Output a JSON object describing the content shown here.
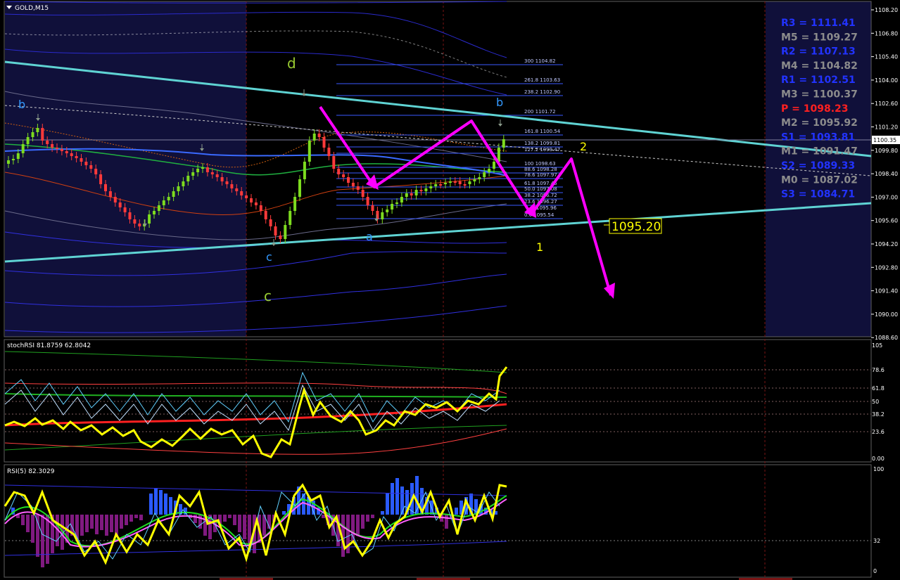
{
  "symbol_label": "GOLD,M15",
  "price_axis": [
    "1108.20",
    "1106.80",
    "1105.40",
    "1104.00",
    "1102.60",
    "1101.20",
    "1099.80",
    "1098.40",
    "1097.00",
    "1095.60",
    "1094.20",
    "1092.80",
    "1091.40",
    "1090.00",
    "1088.60"
  ],
  "current_price": "1100.35",
  "pivots": [
    {
      "label": "R3 = 1111.41",
      "color": "#2233ff"
    },
    {
      "label": "M5 = 1109.27",
      "color": "#8c8c8c"
    },
    {
      "label": "R2 = 1107.13",
      "color": "#2233ff"
    },
    {
      "label": "M4 = 1104.82",
      "color": "#8c8c8c"
    },
    {
      "label": "R1 = 1102.51",
      "color": "#2233ff"
    },
    {
      "label": "M3 = 1100.37",
      "color": "#8c8c8c"
    },
    {
      "label": "P  = 1098.23",
      "color": "#ff2020"
    },
    {
      "label": "M2 = 1095.92",
      "color": "#8c8c8c"
    },
    {
      "label": "S1 = 1093.81",
      "color": "#2233ff"
    },
    {
      "label": "M1 = 1091.47",
      "color": "#8c8c8c"
    },
    {
      "label": "S2 = 1089.33",
      "color": "#2233ff"
    },
    {
      "label": "M0 = 1087.02",
      "color": "#8c8c8c"
    },
    {
      "label": "S3 = 1084.71",
      "color": "#2233ff"
    }
  ],
  "fib_levels": [
    "300 1104.82",
    "261.8 1103.63",
    "238.2 1102.90",
    "200 1101.72",
    "161.8 1100.54",
    "138.2 1099.81",
    "127.2 1099.47",
    "100 1098.63",
    "88.6 1098.28",
    "78.6 1097.97",
    "61.8 1097.45",
    "50.0 1097.08",
    "38.2 1096.72",
    "23.6 1096.27",
    "0.0 1095.54",
    "1095.96"
  ],
  "wave_labels": [
    {
      "text": "d",
      "color": "#9acd32"
    },
    {
      "text": "b",
      "color": "#3399ff"
    },
    {
      "text": "b",
      "color": "#3399ff"
    },
    {
      "text": "c",
      "color": "#3399ff"
    },
    {
      "text": "a",
      "color": "#3399ff"
    },
    {
      "text": "c",
      "color": "#9acd32"
    },
    {
      "text": "2",
      "color": "#ffff00"
    },
    {
      "text": "1",
      "color": "#ffff00"
    }
  ],
  "target_label": "1095.20",
  "stoch_title": "stochRSI 81.8759 62.8042",
  "stoch_axis": [
    "105",
    "78.6",
    "61.8",
    "50",
    "38.2",
    "23.6",
    "0.00"
  ],
  "rsi_title": "RSI(5) 82.3029",
  "rsi_axis": [
    "100",
    "32",
    "0"
  ],
  "colors": {
    "bg": "#000000",
    "shaded": "#10103a",
    "trend": "#5fd3d3",
    "arrow": "#ff00ff",
    "bull": "#7ddc1f",
    "bear": "#ff3a3a",
    "stoch": "#ffff00"
  }
}
